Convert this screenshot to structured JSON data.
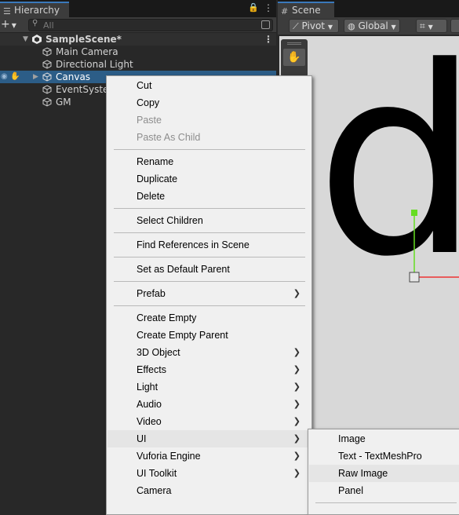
{
  "hierarchy": {
    "tab_label": "Hierarchy",
    "search_placeholder": "All",
    "scene_name": "SampleScene*",
    "items": [
      {
        "label": "Main Camera"
      },
      {
        "label": "Directional Light"
      },
      {
        "label": "Canvas"
      },
      {
        "label": "EventSystem"
      },
      {
        "label": "GM"
      }
    ]
  },
  "scene": {
    "tab_label": "Scene",
    "pivot_label": "Pivot",
    "global_label": "Global",
    "canvas_glyph": "d"
  },
  "context_menu": {
    "items": [
      {
        "label": "Cut"
      },
      {
        "label": "Copy"
      },
      {
        "label": "Paste",
        "disabled": true
      },
      {
        "label": "Paste As Child",
        "disabled": true
      },
      {
        "label": "Rename"
      },
      {
        "label": "Duplicate"
      },
      {
        "label": "Delete"
      },
      {
        "label": "Select Children"
      },
      {
        "label": "Find References in Scene"
      },
      {
        "label": "Set as Default Parent"
      },
      {
        "label": "Prefab",
        "submenu": true
      },
      {
        "label": "Create Empty"
      },
      {
        "label": "Create Empty Parent"
      },
      {
        "label": "3D Object",
        "submenu": true
      },
      {
        "label": "Effects",
        "submenu": true
      },
      {
        "label": "Light",
        "submenu": true
      },
      {
        "label": "Audio",
        "submenu": true
      },
      {
        "label": "Video",
        "submenu": true
      },
      {
        "label": "UI",
        "submenu": true,
        "highlighted": true
      },
      {
        "label": "Vuforia Engine",
        "submenu": true
      },
      {
        "label": "UI Toolkit",
        "submenu": true
      },
      {
        "label": "Camera"
      }
    ]
  },
  "ui_submenu": {
    "items": [
      {
        "label": "Image"
      },
      {
        "label": "Text - TextMeshPro"
      },
      {
        "label": "Raw Image",
        "highlighted": true
      },
      {
        "label": "Panel"
      }
    ]
  },
  "colors": {
    "selection": "#2c5d87",
    "tab_accent": "#3a79bb",
    "menu_background": "#f0f0f0",
    "menu_highlight": "#e5e5e5",
    "gizmo_green": "#66dd22",
    "gizmo_red": "#ee3333"
  },
  "icons": {
    "hierarchy_tab": "list-icon",
    "scene_tab": "grid-icon",
    "lock": "lock-icon",
    "menu": "kebab-icon",
    "add": "plus-icon",
    "game_object": "cube-icon",
    "visibility": "eye-icon",
    "pickability": "hand-icon",
    "submenu": "chevron-right-icon"
  }
}
